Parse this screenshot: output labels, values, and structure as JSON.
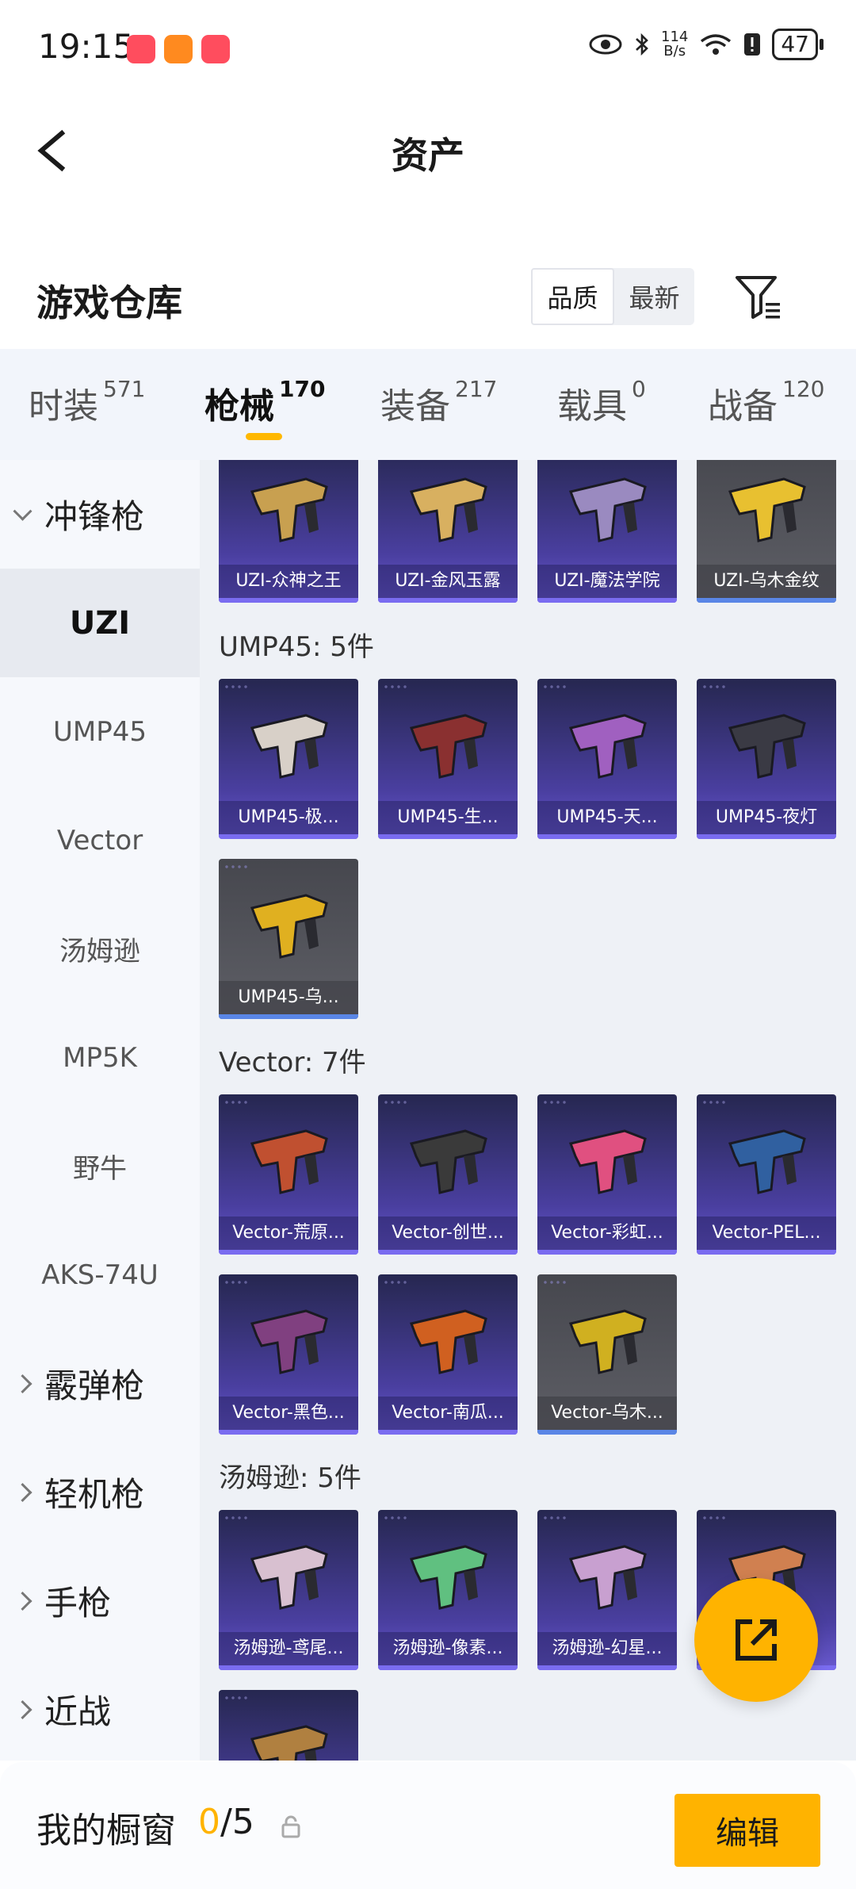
{
  "status_bar": {
    "time": "19:15",
    "net_speed_value": "114",
    "net_speed_unit": "B/s",
    "battery": "47"
  },
  "header": {
    "title": "资产"
  },
  "warehouse": {
    "title": "游戏仓库",
    "sort_options": [
      "品质",
      "最新"
    ],
    "active_sort": "品质"
  },
  "tabs": [
    {
      "label": "时装",
      "count": "571"
    },
    {
      "label": "枪械",
      "count": "170"
    },
    {
      "label": "装备",
      "count": "217"
    },
    {
      "label": "载具",
      "count": "0"
    },
    {
      "label": "战备",
      "count": "120"
    }
  ],
  "active_tab": "枪械",
  "sidenav": [
    {
      "label": "冲锋枪",
      "type": "group",
      "expanded": true
    },
    {
      "label": "UZI",
      "type": "item",
      "selected": true
    },
    {
      "label": "UMP45",
      "type": "item"
    },
    {
      "label": "Vector",
      "type": "item"
    },
    {
      "label": "汤姆逊",
      "type": "item"
    },
    {
      "label": "MP5K",
      "type": "item"
    },
    {
      "label": "野牛",
      "type": "item"
    },
    {
      "label": "AKS-74U",
      "type": "item"
    },
    {
      "label": "霰弹枪",
      "type": "group",
      "expanded": false
    },
    {
      "label": "轻机枪",
      "type": "group",
      "expanded": false
    },
    {
      "label": "手枪",
      "type": "group",
      "expanded": false
    },
    {
      "label": "近战",
      "type": "group",
      "expanded": false
    }
  ],
  "sections": [
    {
      "title": "",
      "items": [
        {
          "name": "UZI-众神之王",
          "grey": false
        },
        {
          "name": "UZI-金风玉露",
          "grey": false
        },
        {
          "name": "UZI-魔法学院",
          "grey": false
        },
        {
          "name": "UZI-乌木金纹",
          "grey": true
        }
      ]
    },
    {
      "title": "UMP45: 5件",
      "items": [
        {
          "name": "UMP45-极...",
          "grey": false
        },
        {
          "name": "UMP45-生...",
          "grey": false
        },
        {
          "name": "UMP45-天...",
          "grey": false
        },
        {
          "name": "UMP45-夜灯",
          "grey": false
        },
        {
          "name": "UMP45-乌...",
          "grey": true
        }
      ]
    },
    {
      "title": "Vector: 7件",
      "items": [
        {
          "name": "Vector-荒原...",
          "grey": false
        },
        {
          "name": "Vector-创世...",
          "grey": false
        },
        {
          "name": "Vector-彩虹...",
          "grey": false
        },
        {
          "name": "Vector-PEL...",
          "grey": false
        },
        {
          "name": "Vector-黑色...",
          "grey": false
        },
        {
          "name": "Vector-南瓜...",
          "grey": false
        },
        {
          "name": "Vector-乌木...",
          "grey": true
        }
      ]
    },
    {
      "title": "汤姆逊: 5件",
      "items": [
        {
          "name": "汤姆逊-鸢尾...",
          "grey": false
        },
        {
          "name": "汤姆逊-像素...",
          "grey": false
        },
        {
          "name": "汤姆逊-幻星...",
          "grey": false
        },
        {
          "name": "",
          "grey": false
        },
        {
          "name": "",
          "grey": false
        }
      ]
    }
  ],
  "bottom_bar": {
    "label": "我的橱窗",
    "current": "0",
    "total": "/5",
    "edit_label": "编辑"
  },
  "colors": {
    "accent": "#ffb300",
    "card_purple": "#4a3fa0",
    "card_grey": "#5e5f66"
  },
  "icons": [
    "back-icon",
    "filter-icon",
    "share-icon",
    "lock-icon",
    "eye-icon",
    "bluetooth-icon",
    "wifi-icon",
    "battery-icon"
  ]
}
